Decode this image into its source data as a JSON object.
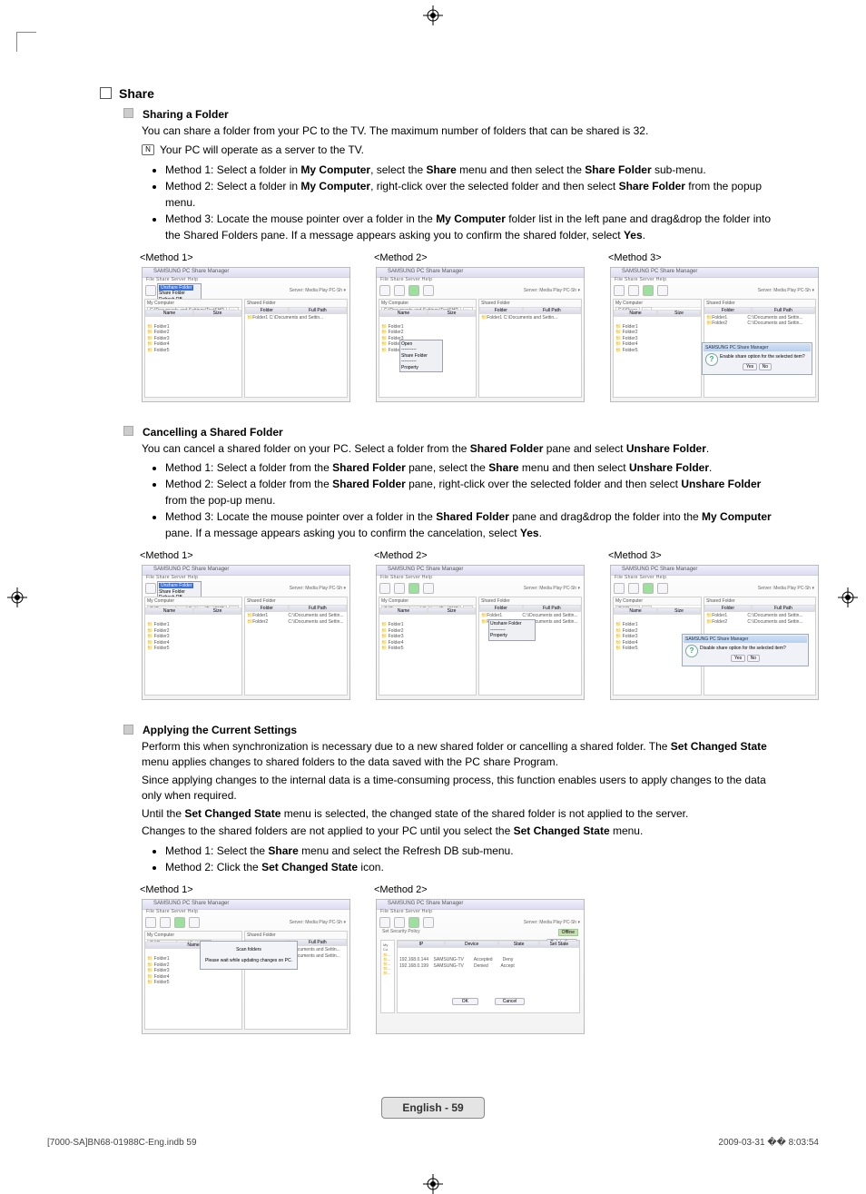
{
  "section_title": "Share",
  "share_folder": {
    "heading": "Sharing a Folder",
    "intro": "You can share a folder from your PC to the TV. The maximum number of folders that can be shared is 32.",
    "note": "Your PC will operate as a server to the TV.",
    "methods": [
      "Method 1: Select a folder in <b>My Computer</b>, select the <b>Share</b> menu and then select the <b>Share Folder</b> sub-menu.",
      "Method 2: Select a folder in <b>My Computer</b>, right-click over the selected folder and then select <b>Share Folder</b> from the popup menu.",
      "Method 3: Locate the mouse pointer over a folder in the <b>My Computer</b> folder list in the left pane and drag&drop the folder into the Shared Folders pane. If a message appears asking you to confirm the shared folder, select <b>Yes</b>."
    ],
    "method_labels": [
      "<Method 1>",
      "<Method 2>",
      "<Method 3>"
    ]
  },
  "cancel_folder": {
    "heading": "Cancelling a Shared Folder",
    "intro": "You can cancel a shared folder on your PC. Select a folder from the <b>Shared Folder</b> pane and select <b>Unshare Folder</b>.",
    "methods": [
      "Method 1: Select a folder from the <b>Shared Folder</b> pane, select the <b>Share</b> menu and then select <b>Unshare Folder</b>.",
      "Method 2: Select a folder from the <b>Shared Folder</b> pane, right-click over the selected folder and then select <b>Unshare Folder</b> from the pop-up menu.",
      "Method 3: Locate the mouse pointer over a folder in the <b>Shared Folder</b> pane and drag&drop the folder into the <b>My Computer</b> pane. If a message appears asking you to confirm the cancelation, select <b>Yes</b>."
    ],
    "method_labels": [
      "<Method 1>",
      "<Method 2>",
      "<Method 3>"
    ]
  },
  "apply": {
    "heading": "Applying the Current Settings",
    "p1": "Perform this when synchronization is necessary due to a new shared folder or cancelling a shared folder. The <b>Set Changed State</b> menu applies changes to shared folders to the data saved with the PC share Program.",
    "p2": "Since applying changes to the internal data is a time-consuming process, this function enables users to apply changes to the data only when required.",
    "p3": "Until the <b>Set Changed State</b> menu is selected, the changed state of the shared folder is not applied to the server.",
    "p4": "Changes to the shared folders are not applied to your PC until you select the <b>Set Changed State</b> menu.",
    "methods": [
      "Method 1: Select the <b>Share</b> menu and select the Refresh DB sub-menu.",
      "Method 2: Click the <b>Set Changed State</b> icon."
    ],
    "method_labels": [
      "<Method 1>",
      "<Method 2>"
    ]
  },
  "shot": {
    "title": "SAMSUNG PC Share Manager",
    "menus": "File   Share   Server   Help",
    "server": "Server:   Media Play  PC-Sh  ▾",
    "lp_label": "My Computer",
    "rp_label": "Shared Folder",
    "path": "C:\\Documents and Settings\\TestSHP",
    "col_name": "Name",
    "col_size": "Size",
    "col_folder": "Folder",
    "col_fullpath": "Full Path",
    "tree1": "📁 Folder1\n📁 Folder2\n📁 Folder3\n📁 Folder4\n📁 Folder5",
    "row1": "📁Folder1                    C:\\Documents and Settin...",
    "popup_share": "Open\n----------\nShare Folder\n----------\nProperty",
    "popup_unshare": "Unshare Folder\n----------\nProperty",
    "dialog_title": "SAMSUNG PC Share Manager",
    "dialog_msg_enable": "Enable share option for the selected item?",
    "dialog_msg_disable": "Disable share option for the selected item?",
    "yes": "Yes",
    "no": "No",
    "menu1_share": "Share Folder\nRefresh DB\nSet Device Policy",
    "menu1_high": "Unshare Folder",
    "updating": "Please wait while updating changes on PC.",
    "policy": "Set Security Policy",
    "pol_head_ip": "IP",
    "pol_head_dev": "Device",
    "pol_head_state": "State",
    "pol_head_set": "Set State",
    "pol_btn1": "Delete Item",
    "pol_r1": "192.168.0.144    SAMSUNG-TV        Accepted        Deny",
    "pol_r2": "192.168.0.199    SAMSUNG-TV        Denied          Accept",
    "ok": "OK",
    "cancel": "Cancel",
    "offline": "Offline"
  },
  "footer": "English - 59",
  "meta_left": "[7000-SA]BN68-01988C-Eng.indb   59",
  "meta_right": "2009-03-31   �� 8:03:54"
}
